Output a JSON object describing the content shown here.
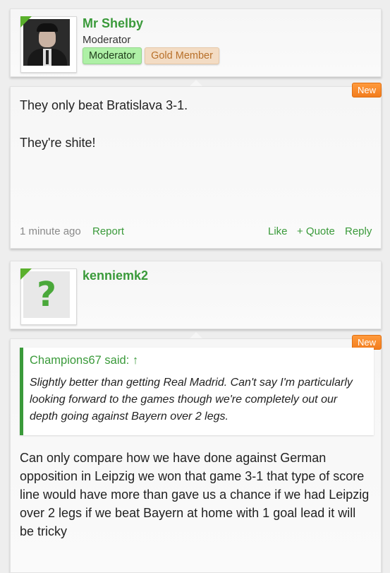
{
  "post1": {
    "username": "Mr Shelby",
    "user_title": "Moderator",
    "banners": [
      "Moderator",
      "Gold Member"
    ],
    "new_badge": "New",
    "message_lines": [
      "They only beat Bratislava 3-1.",
      "They're shite!"
    ],
    "time": "1 minute ago",
    "report": "Report",
    "like": "Like",
    "quote": "+ Quote",
    "reply": "Reply"
  },
  "post2": {
    "username": "kenniemk2",
    "avatar_letter": "?",
    "new_badge": "New",
    "quote_header": "Champions67 said: ↑",
    "quote_text": "Slightly better than getting Real Madrid. Can't say I'm particularly looking forward to the games though we're completely out our depth going against Bayern over 2 legs.",
    "message": "Can only compare how we have done against German opposition in Leipzig we won that game 3-1 that type of score line would have more than gave us a chance if we had Leipzig over 2 legs if we beat Bayern at home with 1 goal lead it will be tricky"
  },
  "colors": {
    "accent": "#3a9a3a",
    "new_badge": "#f27d1e",
    "moderator_banner": "#aef0a6",
    "gold_banner": "#f3dcc4"
  }
}
